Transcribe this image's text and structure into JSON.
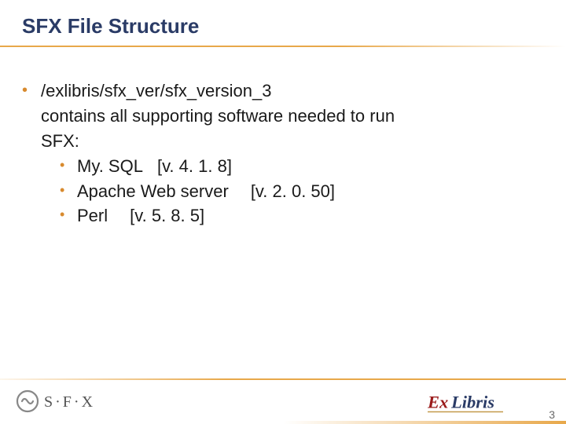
{
  "title": "SFX File Structure",
  "main": {
    "path": "/exlibris/sfx_ver/sfx_version_3",
    "description_line1": "contains all supporting software needed to run",
    "description_line2": "SFX:",
    "items": [
      {
        "name": "My. SQL",
        "version": "[v. 4. 1. 8]"
      },
      {
        "name": "Apache Web server",
        "version": "[v. 2. 0. 50]"
      },
      {
        "name": "Perl",
        "version": "[v. 5. 8. 5]"
      }
    ]
  },
  "footer": {
    "sfx_logo_text": "S·F·X",
    "exlibris_logo_text": "ExLibris",
    "page_number": "3"
  },
  "colors": {
    "title": "#2a3b66",
    "accent": "#e8a84a",
    "bullet": "#d88a2e"
  }
}
